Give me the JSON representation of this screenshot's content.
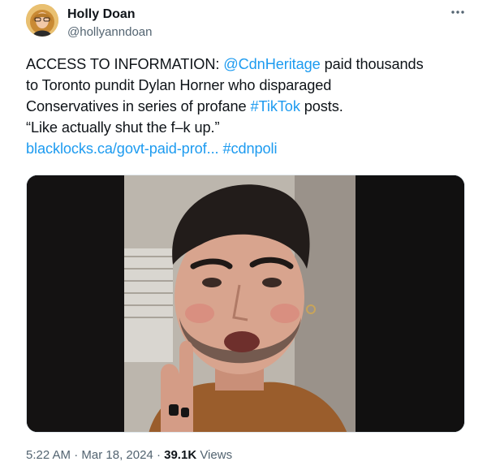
{
  "author": {
    "name": "Holly Doan",
    "handle": "@hollyanndoan"
  },
  "post": {
    "line1_prefix": "ACCESS TO INFORMATION: ",
    "line1_mention": "@CdnHeritage",
    "line1_suffix": " paid thousands",
    "line2": "to Toronto pundit Dylan Horner who disparaged",
    "line3_prefix": "Conservatives in series of profane ",
    "line3_hashtag": "#TikTok",
    "line3_suffix": " posts.",
    "line4": "“Like actually shut the f–k up.”",
    "link_url": "blacklocks.ca/govt-paid-prof...",
    "link_hashtag": "#cdnpoli"
  },
  "meta": {
    "time": "5:22 AM",
    "separator1": " · ",
    "date": "Mar 18, 2024",
    "separator2": " · ",
    "views_count": "39.1K",
    "views_label": " Views"
  },
  "icons": {
    "more": "more-horizontal-icon"
  },
  "colors": {
    "link": "#1d9bf0",
    "secondary_text": "#536471",
    "primary_text": "#0f1419"
  }
}
